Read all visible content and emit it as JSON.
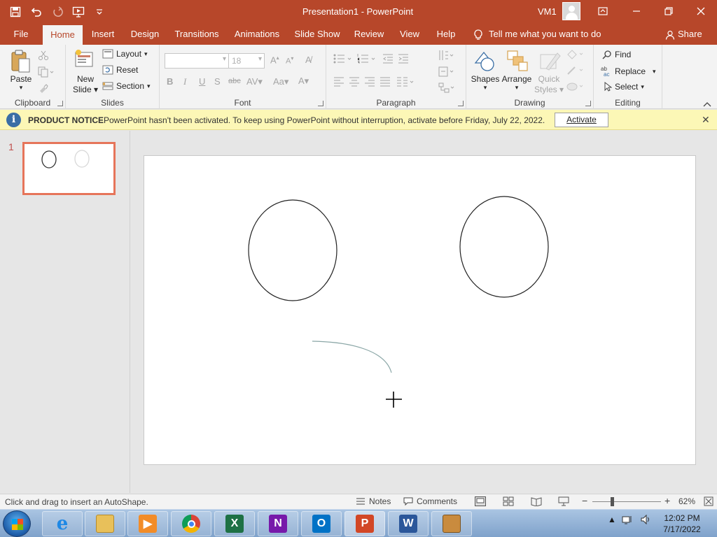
{
  "window": {
    "title": "Presentation1 - PowerPoint",
    "user": "VM1"
  },
  "tabs": [
    "File",
    "Home",
    "Insert",
    "Design",
    "Transitions",
    "Animations",
    "Slide Show",
    "Review",
    "View",
    "Help"
  ],
  "active_tab": "Home",
  "tell_me": "Tell me what you want to do",
  "share": "Share",
  "ribbon": {
    "clipboard": {
      "label": "Clipboard",
      "paste": "Paste"
    },
    "slides": {
      "label": "Slides",
      "new_slide_1": "New",
      "new_slide_2": "Slide",
      "layout": "Layout",
      "reset": "Reset",
      "section": "Section"
    },
    "font": {
      "label": "Font",
      "font_size": "18"
    },
    "paragraph": {
      "label": "Paragraph"
    },
    "drawing": {
      "label": "Drawing",
      "shapes": "Shapes",
      "arrange": "Arrange",
      "quick_styles_1": "Quick",
      "quick_styles_2": "Styles"
    },
    "editing": {
      "label": "Editing",
      "find": "Find",
      "replace": "Replace",
      "select": "Select"
    }
  },
  "notice": {
    "label": "PRODUCT NOTICE",
    "message": "PowerPoint hasn't been activated. To keep using PowerPoint without interruption, activate before Friday, July 22, 2022.",
    "button": "Activate"
  },
  "thumbnails": [
    {
      "number": "1"
    }
  ],
  "status": {
    "hint": "Click and drag to insert an AutoShape.",
    "notes": "Notes",
    "comments": "Comments",
    "zoom": "62%"
  },
  "taskbar": {
    "apps": [
      "Internet Explorer",
      "File Explorer",
      "Media Player",
      "Chrome",
      "Excel",
      "OneNote",
      "Outlook",
      "PowerPoint",
      "Word",
      "Windows Pinned App"
    ],
    "active_app": "PowerPoint",
    "time": "12:02 PM",
    "date": "7/17/2022"
  },
  "colors": {
    "accent": "#b7472a",
    "notice_bg": "#fcf7b6",
    "thumbnail_border": "#e6755a"
  }
}
